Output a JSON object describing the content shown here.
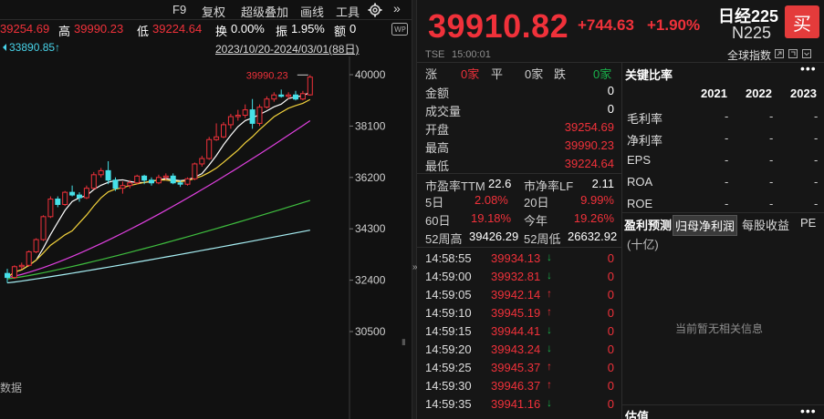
{
  "toolbar": {
    "f9": "F9",
    "restore": "复权",
    "overlay": "超级叠加",
    "draw": "画线",
    "tools": "工具"
  },
  "quote_row": {
    "open_value": "39254.69",
    "high_label": "高",
    "high_value": "39990.23",
    "low_label": "低",
    "low_value": "39224.64",
    "turnover_label": "换",
    "turnover_value": "0.00%",
    "amplitude_label": "振",
    "amplitude_value": "1.95%",
    "amount_label": "额",
    "amount_value": "0"
  },
  "range_row": {
    "ma_value": "33890.85↑",
    "date_range": "2023/10/20-2024/03/01(88日)"
  },
  "chart": {
    "max_label": "39990.23",
    "y_ticks": [
      "40000",
      "38100",
      "36200",
      "34300",
      "32400",
      "30500"
    ],
    "bottom_label": "数据"
  },
  "chart_data": {
    "type": "candlestick",
    "y_ticks": [
      40000,
      38100,
      36200,
      34300,
      32400,
      30500
    ],
    "annotated_high": 39990.23,
    "ylim": [
      30000,
      40500
    ],
    "candles": [
      {
        "o": 32650,
        "h": 32820,
        "l": 32300,
        "c": 32500
      },
      {
        "o": 32500,
        "h": 32950,
        "l": 32450,
        "c": 32900
      },
      {
        "o": 32900,
        "h": 33050,
        "l": 32800,
        "c": 32950
      },
      {
        "o": 32950,
        "h": 33500,
        "l": 32900,
        "c": 33450
      },
      {
        "o": 33450,
        "h": 33950,
        "l": 33400,
        "c": 33900
      },
      {
        "o": 33900,
        "h": 34800,
        "l": 33850,
        "c": 34750
      },
      {
        "o": 34750,
        "h": 35500,
        "l": 34700,
        "c": 35400
      },
      {
        "o": 35400,
        "h": 35500,
        "l": 35100,
        "c": 35200
      },
      {
        "o": 35200,
        "h": 35700,
        "l": 35150,
        "c": 35650
      },
      {
        "o": 35650,
        "h": 35900,
        "l": 35500,
        "c": 35550
      },
      {
        "o": 35550,
        "h": 35650,
        "l": 35300,
        "c": 35450
      },
      {
        "o": 35450,
        "h": 35900,
        "l": 35400,
        "c": 35800
      },
      {
        "o": 35800,
        "h": 36400,
        "l": 35750,
        "c": 36300
      },
      {
        "o": 36300,
        "h": 36550,
        "l": 36200,
        "c": 36450
      },
      {
        "o": 36450,
        "h": 36800,
        "l": 35950,
        "c": 36100
      },
      {
        "o": 36100,
        "h": 36200,
        "l": 35700,
        "c": 35800
      },
      {
        "o": 35800,
        "h": 36050,
        "l": 35600,
        "c": 35900
      },
      {
        "o": 35900,
        "h": 36100,
        "l": 35800,
        "c": 36000
      },
      {
        "o": 36000,
        "h": 36300,
        "l": 35950,
        "c": 36250
      },
      {
        "o": 36250,
        "h": 36300,
        "l": 35950,
        "c": 36100
      },
      {
        "o": 36100,
        "h": 36200,
        "l": 35900,
        "c": 36000
      },
      {
        "o": 36000,
        "h": 36300,
        "l": 35950,
        "c": 36200
      },
      {
        "o": 36200,
        "h": 36350,
        "l": 36100,
        "c": 36250
      },
      {
        "o": 36250,
        "h": 36350,
        "l": 35950,
        "c": 36000
      },
      {
        "o": 36000,
        "h": 36100,
        "l": 35850,
        "c": 35950
      },
      {
        "o": 35950,
        "h": 36200,
        "l": 35900,
        "c": 36150
      },
      {
        "o": 36150,
        "h": 36750,
        "l": 36100,
        "c": 36700
      },
      {
        "o": 36700,
        "h": 37000,
        "l": 36600,
        "c": 36900
      },
      {
        "o": 36900,
        "h": 37700,
        "l": 36850,
        "c": 37600
      },
      {
        "o": 37600,
        "h": 38200,
        "l": 37550,
        "c": 37700
      },
      {
        "o": 37700,
        "h": 38250,
        "l": 37650,
        "c": 38150
      },
      {
        "o": 38150,
        "h": 38550,
        "l": 38000,
        "c": 38450
      },
      {
        "o": 38450,
        "h": 38700,
        "l": 38300,
        "c": 38500
      },
      {
        "o": 38500,
        "h": 38900,
        "l": 38400,
        "c": 38700
      },
      {
        "o": 38700,
        "h": 39100,
        "l": 38000,
        "c": 38200
      },
      {
        "o": 38200,
        "h": 38900,
        "l": 38100,
        "c": 38800
      },
      {
        "o": 38800,
        "h": 39200,
        "l": 38750,
        "c": 39100
      },
      {
        "o": 39100,
        "h": 39350,
        "l": 39000,
        "c": 39250
      },
      {
        "o": 39250,
        "h": 39450,
        "l": 39150,
        "c": 39200
      },
      {
        "o": 39200,
        "h": 39350,
        "l": 39100,
        "c": 39250
      },
      {
        "o": 39250,
        "h": 39400,
        "l": 39050,
        "c": 39100
      },
      {
        "o": 39100,
        "h": 39400,
        "l": 39050,
        "c": 39300
      },
      {
        "o": 39254.69,
        "h": 39990.23,
        "l": 39224.64,
        "c": 39910.82
      }
    ]
  },
  "header": {
    "price": "39910.82",
    "change": "+744.63",
    "change_pct": "+1.90%",
    "name": "日经225",
    "code": "N225",
    "buy_label": "买",
    "exchange": "TSE",
    "time": "15:00:01",
    "index_type": "全球指数"
  },
  "breadth": {
    "up_label": "涨",
    "up_value": "0家",
    "flat_label": "平",
    "flat_value": "0家",
    "down_label": "跌",
    "down_value": "0家"
  },
  "stats": [
    {
      "label": "金额",
      "value": "0"
    },
    {
      "label": "成交量",
      "value": "0"
    },
    {
      "label": "开盘",
      "value": "39254.69"
    },
    {
      "label": "最高",
      "value": "39990.23"
    },
    {
      "label": "最低",
      "value": "39224.64"
    }
  ],
  "valuation": {
    "pe_label": "市盈率TTM",
    "pe_value": "22.6",
    "pb_label": "市净率LF",
    "pb_value": "2.11",
    "d5_label": "5日",
    "d5_value": "2.08%",
    "d20_label": "20日",
    "d20_value": "9.99%",
    "d60_label": "60日",
    "d60_value": "19.18%",
    "ytd_label": "今年",
    "ytd_value": "19.26%",
    "wk52h_label": "52周高",
    "wk52h_value": "39426.29",
    "wk52l_label": "52周低",
    "wk52l_value": "26632.92"
  },
  "ticks": [
    {
      "time": "14:58:55",
      "price": "39934.13",
      "dir": "down",
      "vol": "0"
    },
    {
      "time": "14:59:00",
      "price": "39932.81",
      "dir": "down",
      "vol": "0"
    },
    {
      "time": "14:59:05",
      "price": "39942.14",
      "dir": "up",
      "vol": "0"
    },
    {
      "time": "14:59:10",
      "price": "39945.19",
      "dir": "up",
      "vol": "0"
    },
    {
      "time": "14:59:15",
      "price": "39944.41",
      "dir": "down",
      "vol": "0"
    },
    {
      "time": "14:59:20",
      "price": "39943.24",
      "dir": "down",
      "vol": "0"
    },
    {
      "time": "14:59:25",
      "price": "39945.37",
      "dir": "up",
      "vol": "0"
    },
    {
      "time": "14:59:30",
      "price": "39946.37",
      "dir": "up",
      "vol": "0"
    },
    {
      "time": "14:59:35",
      "price": "39941.16",
      "dir": "down",
      "vol": "0"
    }
  ],
  "key_ratios": {
    "title": "关键比率",
    "years": [
      "2021",
      "2022",
      "2023"
    ],
    "rows": [
      {
        "label": "毛利率",
        "values": [
          "-",
          "-",
          "-"
        ]
      },
      {
        "label": "净利率",
        "values": [
          "-",
          "-",
          "-"
        ]
      },
      {
        "label": "EPS",
        "values": [
          "-",
          "-",
          "-"
        ]
      },
      {
        "label": "ROA",
        "values": [
          "-",
          "-",
          "-"
        ]
      },
      {
        "label": "ROE",
        "values": [
          "-",
          "-",
          "-"
        ]
      }
    ]
  },
  "forecast": {
    "tabs": [
      "盈利预测",
      "归母净利润",
      "每股收益",
      "PE"
    ],
    "unit": "(十亿)",
    "empty": "当前暂无相关信息",
    "valuation_title": "估值"
  },
  "colors": {
    "up": "#f0313a",
    "down": "#19b34b",
    "accent": "#e43b3b"
  }
}
